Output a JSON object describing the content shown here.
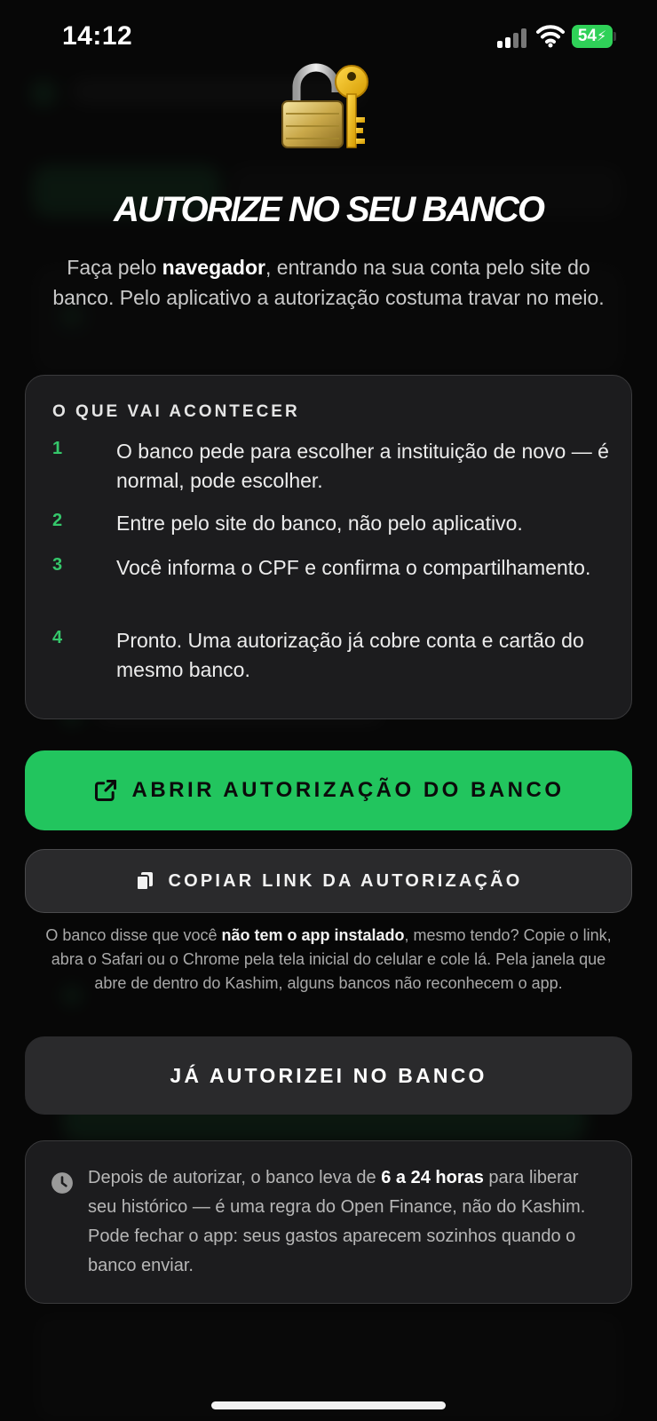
{
  "status_bar": {
    "time": "14:12",
    "battery": "54"
  },
  "main": {
    "title": "AUTORIZE NO SEU BANCO",
    "intro_before": "Faça pelo ",
    "intro_bold": "navegador",
    "intro_after": ", entrando na sua conta pelo site do banco. Pelo aplicativo a autorização costuma travar no meio."
  },
  "steps_card": {
    "heading": "O QUE VAI ACONTECER",
    "steps": [
      {
        "num": "1",
        "text": "O banco pede para escolher a instituição de novo — é normal, pode escolher."
      },
      {
        "num": "2",
        "text": "Entre pelo site do banco, não pelo aplicativo."
      },
      {
        "num": "3",
        "text": "Você informa o CPF e confirma o compartilhamento."
      },
      {
        "num": "4",
        "text": "Pronto. Uma autorização já cobre conta e cartão do mesmo banco."
      }
    ]
  },
  "buttons": {
    "open_auth": "ABRIR AUTORIZAÇÃO DO BANCO",
    "copy_link": "COPIAR LINK DA AUTORIZAÇÃO",
    "done": "JÁ AUTORIZEI NO BANCO"
  },
  "help": {
    "before": "O banco disse que você ",
    "bold": "não tem o app instalado",
    "after": ", mesmo tendo? Copie o link, abra o Safari ou o Chrome pela tela inicial do celular e cole lá. Pela janela que abre de dentro do Kashim, alguns bancos não reconhecem o app."
  },
  "info": {
    "before": "Depois de autorizar, o banco leva de ",
    "bold": "6 a 24 horas",
    "after": " para liberar seu histórico — é uma regra do Open Finance, não do Kashim. Pode fechar o app: seus gastos aparecem sozinhos quando o banco enviar."
  },
  "icons": {
    "lock": "lock-with-key-icon",
    "open": "external-link-icon",
    "copy": "copy-icon",
    "clock": "clock-icon"
  },
  "colors": {
    "accent_green": "#22c55e",
    "step_number_green": "#35c76b",
    "card_bg": "#1c1c1e",
    "button_dark": "#2a2a2c"
  }
}
